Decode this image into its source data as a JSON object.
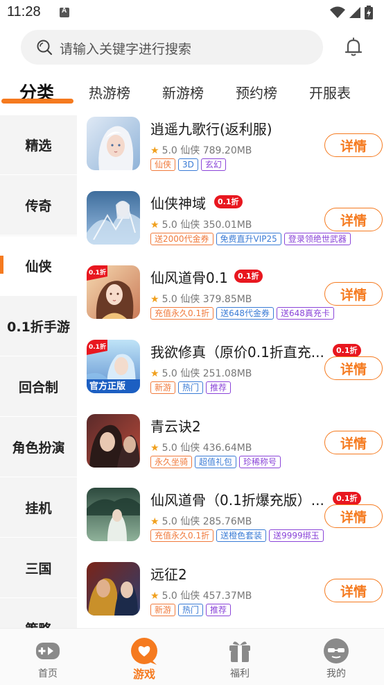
{
  "status": {
    "time": "11:28"
  },
  "search": {
    "placeholder": "请输入关键字进行搜索"
  },
  "tabs": [
    {
      "label": "分类"
    },
    {
      "label": "热游榜"
    },
    {
      "label": "新游榜"
    },
    {
      "label": "预约榜"
    },
    {
      "label": "开服表"
    }
  ],
  "sidebar": {
    "items": [
      {
        "label": "精选"
      },
      {
        "label": "传奇"
      },
      {
        "label": "仙侠"
      },
      {
        "label": "0.1折手游"
      },
      {
        "label": "回合制"
      },
      {
        "label": "角色扮演"
      },
      {
        "label": "挂机"
      },
      {
        "label": "三国"
      },
      {
        "label": "策略"
      }
    ]
  },
  "games": [
    {
      "name": "逍遥九歌行(返利服)",
      "discount": "",
      "rating": "5.0",
      "category": "仙侠",
      "size": "789.20MB",
      "tags": [
        "仙侠",
        "3D",
        "玄幻"
      ],
      "button": "详情"
    },
    {
      "name": "仙侠神域",
      "discount": "0.1折",
      "rating": "5.0",
      "category": "仙侠",
      "size": "350.01MB",
      "tags": [
        "送2000代金券",
        "免费直升VIP25",
        "登录领绝世武器"
      ],
      "button": "详情"
    },
    {
      "name": "仙风道骨0.1",
      "discount": "0.1折",
      "rating": "5.0",
      "category": "仙侠",
      "size": "379.85MB",
      "tags": [
        "充值永久0.1折",
        "送648代金券",
        "送648真充卡"
      ],
      "button": "详情"
    },
    {
      "name": "我欲修真（原价0.1折直充...",
      "discount": "0.1折",
      "rating": "5.0",
      "category": "仙侠",
      "size": "251.08MB",
      "tags": [
        "新游",
        "热门",
        "推荐"
      ],
      "button": "详情"
    },
    {
      "name": "青云诀2",
      "discount": "",
      "rating": "5.0",
      "category": "仙侠",
      "size": "436.64MB",
      "tags": [
        "永久坐骑",
        "超值礼包",
        "珍稀称号"
      ],
      "button": "详情"
    },
    {
      "name": "仙风道骨（0.1折爆充版）...",
      "discount": "0.1折",
      "rating": "5.0",
      "category": "仙侠",
      "size": "285.76MB",
      "tags": [
        "充值永久0.1折",
        "送橙色套装",
        "送9999绑玉"
      ],
      "button": "详情"
    },
    {
      "name": "远征2",
      "discount": "",
      "rating": "5.0",
      "category": "仙侠",
      "size": "457.37MB",
      "tags": [
        "新游",
        "热门",
        "推荐"
      ],
      "button": "详情"
    }
  ],
  "icon_badges": {
    "game3": "0.1折",
    "game4_top": "0.1折",
    "game4_bottom": "官方正版"
  },
  "bottom_nav": [
    {
      "label": "首页",
      "icon": "gamepad-icon"
    },
    {
      "label": "游戏",
      "icon": "heart-chat-icon"
    },
    {
      "label": "福利",
      "icon": "gift-icon"
    },
    {
      "label": "我的",
      "icon": "avatar-icon"
    }
  ],
  "colors": {
    "accent": "#f57a1f",
    "discount": "#e8171f",
    "tag_orange": "#f07a3c",
    "tag_blue": "#3a7bd5",
    "tag_purple": "#8a44d8"
  }
}
